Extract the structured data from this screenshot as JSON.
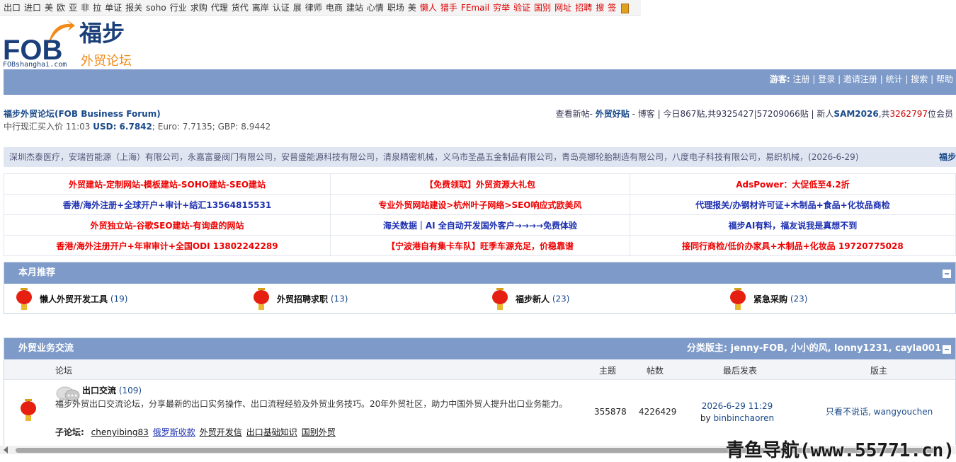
{
  "topnav": {
    "links": [
      "出口",
      "进口",
      "美",
      "欧",
      "亚",
      "非",
      "拉",
      "单证",
      "报关",
      "soho",
      "行业",
      "求购",
      "代理",
      "货代",
      "离岸",
      "认证",
      "展",
      "律师",
      "电商",
      "建站",
      "心情",
      "职场",
      "美"
    ],
    "red_links": [
      "懒人",
      "猎手",
      "FEmail",
      "穷举",
      "验证",
      "国别",
      "网址",
      "招聘",
      "搜",
      "签"
    ]
  },
  "logo": {
    "fob": "FOB",
    "site": "FOBshanghai.com",
    "name": "福步",
    "tagline": "外贸论坛"
  },
  "userbar": {
    "guest": "游客:",
    "items": [
      "注册",
      "登录",
      "邀请注册",
      "统计",
      "搜索",
      "帮助"
    ]
  },
  "info": {
    "forum_name": "福步外贸论坛(FOB Business Forum)",
    "rate_prefix": "中行现汇买入价 11:03",
    "usd": "USD: 6.7842",
    "rest": "; Euro: 7.7135; GBP: 8.9442",
    "right_1": "查看新帖-",
    "right_hot": "外贸好贴",
    "right_2": "- 博客 | 今日867贴,共9325427|57209066贴 | 新人",
    "right_user": "SAM2026",
    "right_3": ",共",
    "right_members": "3262797",
    "right_4": "位会员"
  },
  "ticker": {
    "text": "深圳杰泰医疗，安瑞哲能源（上海）有限公司，永嘉富曼阀门有限公司，安普盛能源科技有限公司，清泉精密机械，义乌市圣晶五金制品有限公司，青岛亮娜轮胎制造有限公司，八度电子科技有限公司，易织机械，(2026-6-29)",
    "more": "福步"
  },
  "ads": [
    [
      {
        "text": "外贸建站-定制网站-模板建站-SOHO建站-SEO建站",
        "color": "red"
      },
      {
        "text": "【免费领取】外贸资源大礼包",
        "color": "red"
      },
      {
        "text": "AdsPower：大促低至4.2折",
        "color": "red"
      }
    ],
    [
      {
        "text": "香港/海外注册+全球开户+审计+结汇13564815531",
        "color": "blue"
      },
      {
        "text": "专业外贸网站建设>杭州叶子网络>SEO响应式欧美风",
        "color": "red"
      },
      {
        "text": "代理报关/办钢材许可证+木制品+食品+化妆品商检",
        "color": "blue"
      }
    ],
    [
      {
        "text": "外贸独立站-谷歌SEO建站-有询盘的网站",
        "color": "red"
      },
      {
        "text": "海关数据｜AI 全自动开发国外客户→→→→免费体验",
        "color": "blue"
      },
      {
        "text": "福步AI有料，福友说我是真想不到",
        "color": "blue"
      }
    ],
    [
      {
        "text": "香港/海外注册开户+年审审计+全国ODI 13802242289",
        "color": "red"
      },
      {
        "text": "【宁波港自有集卡车队】旺季车源充足，价稳靠谱",
        "color": "red"
      },
      {
        "text": "接同行商检/低价办家具+木制品+化妆品 19720775028",
        "color": "red"
      }
    ]
  ],
  "monthly": {
    "title": "本月推荐",
    "items": [
      {
        "title": "懒人外贸开发工具",
        "count": "(19)"
      },
      {
        "title": "外贸招聘求职",
        "count": "(13)"
      },
      {
        "title": "福步新人",
        "count": "(23)"
      },
      {
        "title": "紧急采购",
        "count": "(23)"
      }
    ]
  },
  "trade": {
    "title": "外贸业务交流",
    "moderators": "分类版主: jenny-FOB, 小小的风, lonny1231, cayla001",
    "columns": {
      "forum": "论坛",
      "topics": "主题",
      "posts": "帖数",
      "last": "最后发表",
      "mod": "版主"
    },
    "row": {
      "name": "出口交流",
      "count": "(109)",
      "desc": "福步外贸出口交流论坛，分享最新的出口实务操作、出口流程经验及外贸业务技巧。20年外贸社区，助力中国外贸人提升出口业务能力。",
      "sub_label": "子论坛:",
      "subs": [
        "chenyibing83",
        "俄罗斯收款",
        "外贸开发信",
        "出口基础知识",
        "国别外贸"
      ],
      "topics": "355878",
      "posts": "4226429",
      "last_time": "2026-6-29 11:29",
      "last_by_prefix": "by",
      "last_by": "binbinchaoren",
      "mods": "只看不说话, wangyouchen"
    }
  },
  "watermark": "青鱼导航(www.55771.cn)",
  "colors": {
    "header_blue": "#7d9ac9",
    "link_blue": "#1a4a8a",
    "ad_red": "#ee0000",
    "ad_blue": "#1c2fb0",
    "lantern": "#e52010"
  }
}
